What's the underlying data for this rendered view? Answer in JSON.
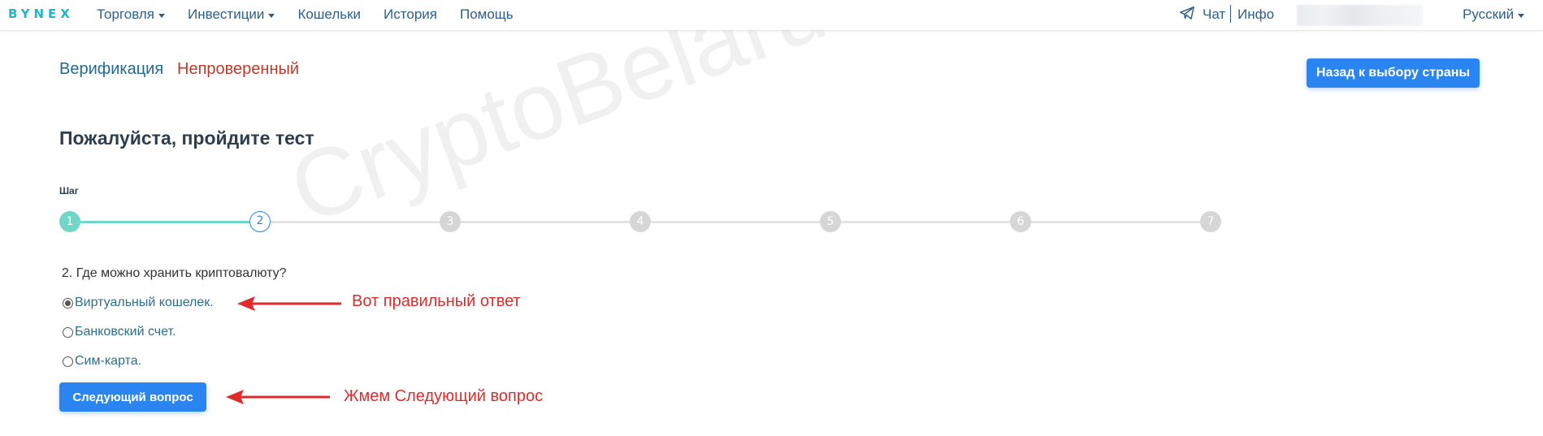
{
  "header": {
    "logo": "BYNEX",
    "nav": [
      {
        "label": "Торговля",
        "dropdown": true
      },
      {
        "label": "Инвестиции",
        "dropdown": true
      },
      {
        "label": "Кошельки",
        "dropdown": false
      },
      {
        "label": "История",
        "dropdown": false
      },
      {
        "label": "Помощь",
        "dropdown": false
      }
    ],
    "chat": "Чат",
    "info": "Инфо",
    "language": "Русский"
  },
  "verification": {
    "title": "Верификация",
    "status": "Непроверенный",
    "back_button": "Назад к выбору страны"
  },
  "test": {
    "heading": "Пожалуйста, пройдите тест",
    "step_label": "Шаг",
    "steps": [
      "1",
      "2",
      "3",
      "4",
      "5",
      "6",
      "7"
    ],
    "current_step": 2,
    "question": "2. Где можно хранить криптовалюту?",
    "options": [
      {
        "label": "Виртуальный кошелек.",
        "checked": true
      },
      {
        "label": "Банковский счет.",
        "checked": false
      },
      {
        "label": "Сим-карта.",
        "checked": false
      }
    ],
    "next_button": "Следующий вопрос"
  },
  "annotations": {
    "correct_answer": "Вот правильный ответ",
    "press_next": "Жмем Следующий вопрос"
  },
  "watermark": "CryptoBelarus.by",
  "colors": {
    "accent": "#2a85f0",
    "link": "#2d5f8a",
    "status_red": "#c0392b",
    "step_done": "#6fd6c8",
    "annotation_red": "#e02b2b"
  }
}
